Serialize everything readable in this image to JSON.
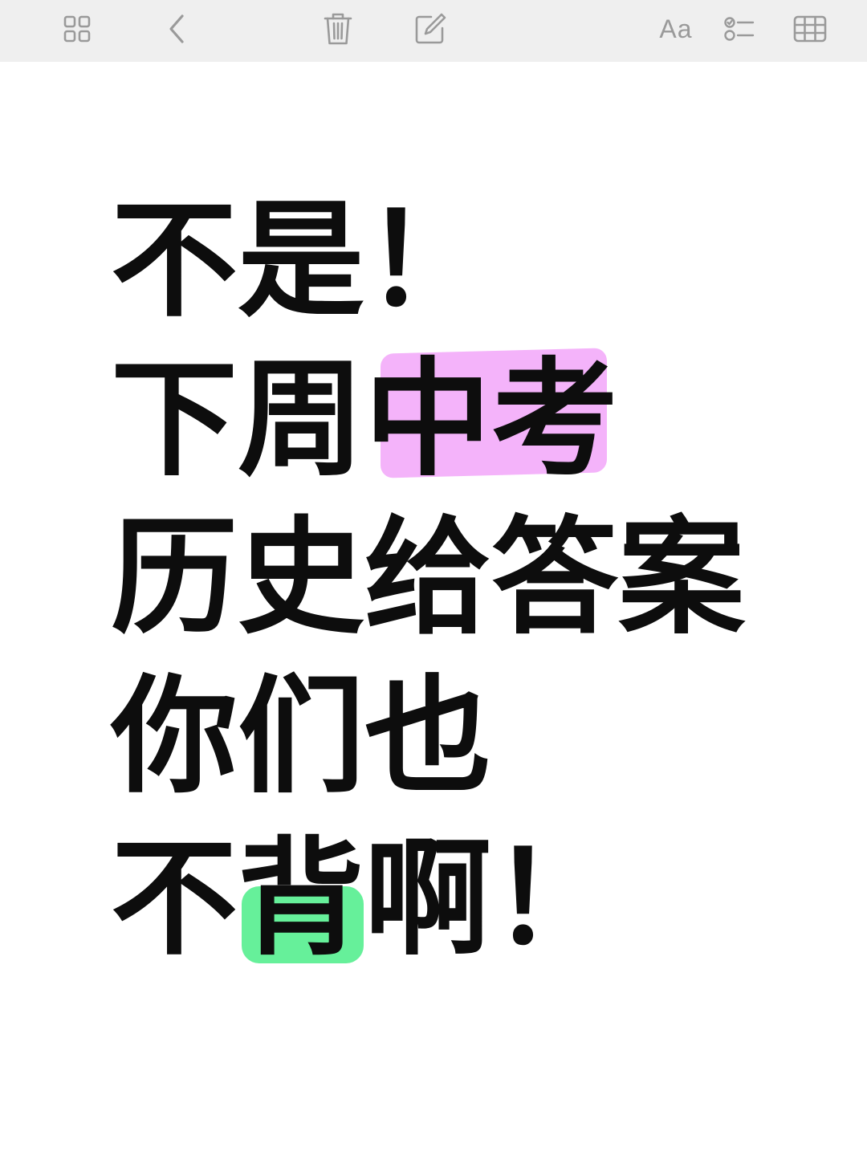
{
  "toolbar": {
    "left_icons": [
      "grid-view-icon",
      "back-chevron-icon",
      "trash-icon",
      "compose-icon"
    ],
    "format_label": "Aa",
    "right_icons": [
      "checklist-icon",
      "table-icon"
    ]
  },
  "note": {
    "lines": [
      {
        "text": "不是！"
      },
      {
        "text_before": "下周",
        "text_highlight": "中考",
        "highlight_color": "#f4b3fa"
      },
      {
        "text": "历史给答案"
      },
      {
        "text": "你们也"
      },
      {
        "text_before": "不",
        "text_highlight": "背",
        "text_after": "啊！",
        "highlight_color": "#66f09a"
      }
    ]
  }
}
